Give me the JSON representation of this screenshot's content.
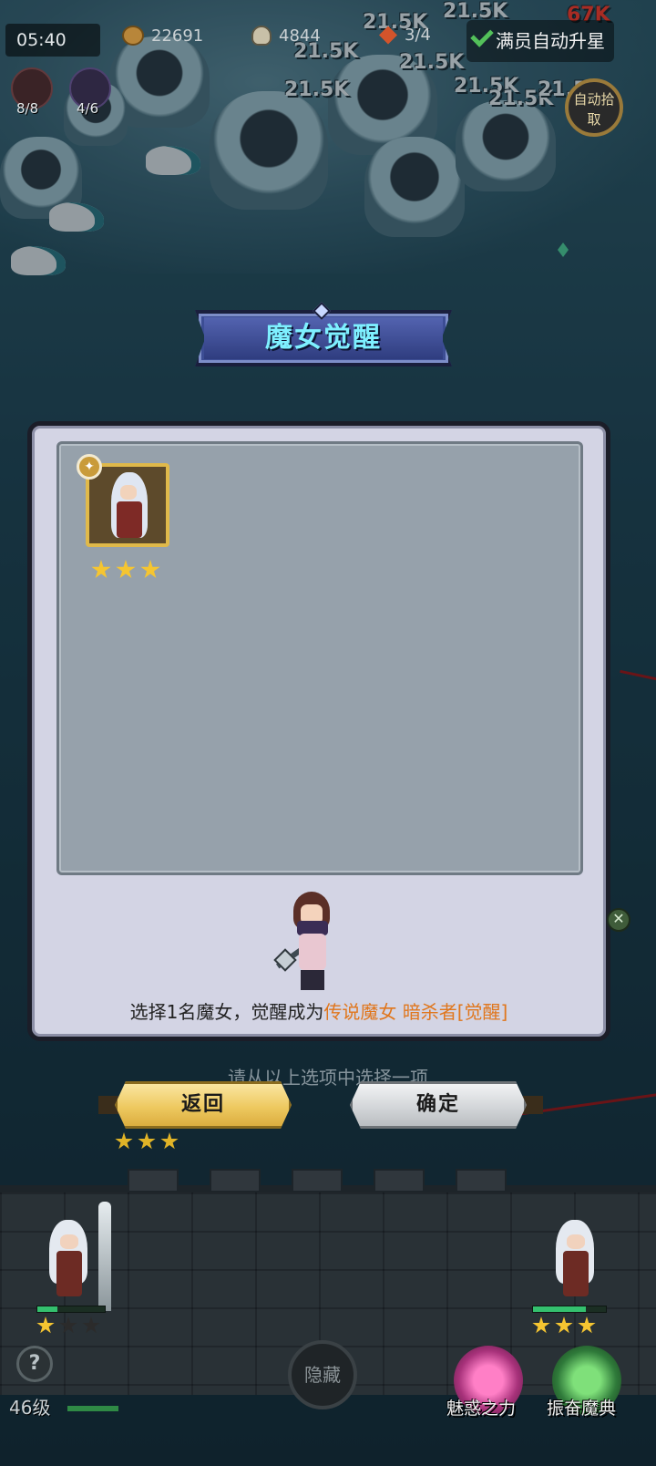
{
  "hud": {
    "timer": "05:40",
    "gold": "22691",
    "kills": "4844",
    "wave": "3/4",
    "auto_upgrade_label": "满员自动升星",
    "auto_pickup_label": "自动拾取",
    "skill_counts": [
      "8/8",
      "4/6"
    ]
  },
  "damage_numbers": [
    "21.5K",
    "21.5K",
    "21.5K",
    "21.5K",
    "21.5K",
    "21.5K",
    "21.5K",
    "21.5K",
    "67K"
  ],
  "dialog": {
    "title": "魔女觉醒",
    "candidate": {
      "name": "witch-card",
      "stars": 3
    },
    "description_prefix": "选择1名魔女，觉醒成为",
    "description_highlight": "传说魔女 暗杀者[觉醒]"
  },
  "buttons": {
    "hint": "请从以上选项中选择一项",
    "back": "返回",
    "confirm": "确定"
  },
  "bottom": {
    "help": "?",
    "hide": "隐藏",
    "charm_power": "魅惑之力",
    "inspire_book": "振奋魔典",
    "level": "46级"
  },
  "colors": {
    "title_text": "#7ef0ff",
    "highlight": "#e0761c",
    "back_button": "#eec960",
    "confirm_button": "#d3d6d9",
    "star": "#f5c531"
  }
}
